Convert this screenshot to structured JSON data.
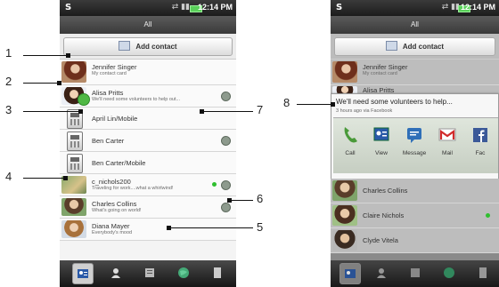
{
  "phone1": {
    "status": {
      "carrier_icon": "S",
      "time": "12:14 PM"
    },
    "title": "All",
    "add_contact": "Add contact",
    "contacts": [
      {
        "name": "Jennifer Singer",
        "sub": "My contact card"
      },
      {
        "name": "Alisa Pritts",
        "sub": "We'll need some volunteers to help out..."
      },
      {
        "name": "April Lin/Mobile",
        "sub": ""
      },
      {
        "name": "Ben Carter",
        "sub": ""
      },
      {
        "name": "Ben Carter/Mobile",
        "sub": ""
      },
      {
        "name": "c_nichols200",
        "sub": "Traveling for work....what a whirlwind!"
      },
      {
        "name": "Charles Collins",
        "sub": "What's going on world!"
      },
      {
        "name": "Diana Mayer",
        "sub": "Everybody's mood"
      }
    ]
  },
  "phone2": {
    "status": {
      "carrier_icon": "S",
      "time": "12:14 PM"
    },
    "title": "All",
    "add_contact": "Add contact",
    "contacts": [
      {
        "name": "Jennifer Singer",
        "sub": "My contact card"
      },
      {
        "name": "Alisa Pritts",
        "sub": ""
      },
      {
        "name": "Charles Collins",
        "sub": ""
      },
      {
        "name": "Claire Nichols",
        "sub": ""
      },
      {
        "name": "Clyde Vitela",
        "sub": ""
      }
    ],
    "popup": {
      "message": "We'll need some volunteers to help...",
      "time": "3 hours ago via Facebook",
      "actions": [
        "Call",
        "View",
        "Message",
        "Mail",
        "Fac"
      ]
    }
  },
  "callouts": [
    "1",
    "2",
    "3",
    "4",
    "5",
    "6",
    "7",
    "8"
  ],
  "colors": {
    "online": "#2fbf2f",
    "accent_red": "#d22b2b"
  }
}
